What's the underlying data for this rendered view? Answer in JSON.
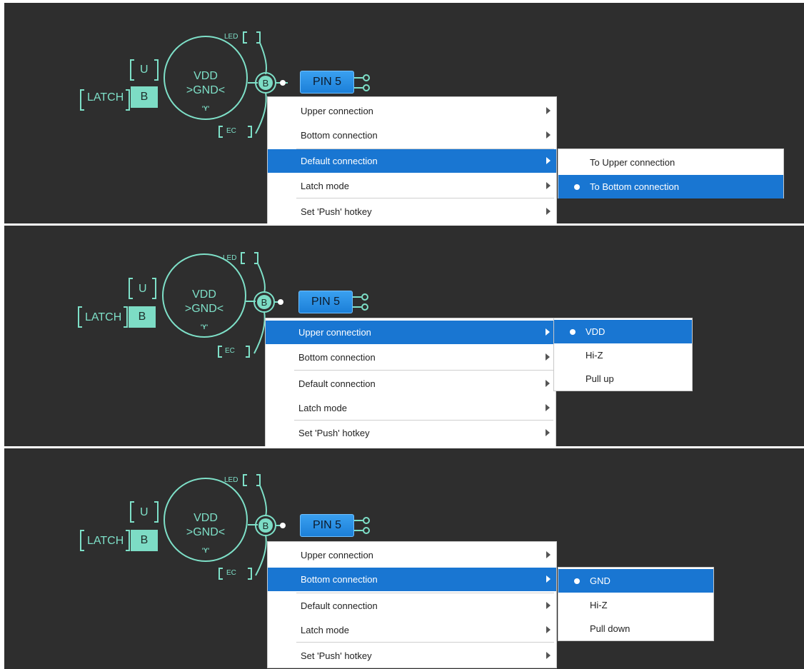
{
  "colors": {
    "background": "#2e2e2e",
    "accent": "#7ddcc5",
    "highlight": "#1976d2",
    "pin": "#2b8fe6"
  },
  "panels": [
    {
      "diagram": {
        "latch": "LATCH",
        "u": "U",
        "b": "B",
        "vdd": "VDD",
        "gnd": ">GND<",
        "y": "'Y'",
        "led": "LED",
        "ec": "EC",
        "node": "B",
        "pin": "PIN 5"
      },
      "menu": [
        "Upper connection",
        "Bottom connection",
        "Default connection",
        "Latch mode",
        "Set 'Push' hotkey"
      ],
      "submenu": [
        "To Upper connection",
        "To Bottom connection"
      ]
    },
    {
      "diagram": {
        "latch": "LATCH",
        "u": "U",
        "b": "B",
        "vdd": "VDD",
        "gnd": ">GND<",
        "y": "'Y'",
        "led": "LED",
        "ec": "EC",
        "node": "B",
        "pin": "PIN 5"
      },
      "menu": [
        "Upper connection",
        "Bottom connection",
        "Default connection",
        "Latch mode",
        "Set 'Push' hotkey"
      ],
      "submenu": [
        "VDD",
        "Hi-Z",
        "Pull up"
      ]
    },
    {
      "diagram": {
        "latch": "LATCH",
        "u": "U",
        "b": "B",
        "vdd": "VDD",
        "gnd": ">GND<",
        "y": "'Y'",
        "led": "LED",
        "ec": "EC",
        "node": "B",
        "pin": "PIN 5"
      },
      "menu": [
        "Upper connection",
        "Bottom connection",
        "Default connection",
        "Latch mode",
        "Set 'Push' hotkey"
      ],
      "submenu": [
        "GND",
        "Hi-Z",
        "Pull down"
      ]
    }
  ]
}
